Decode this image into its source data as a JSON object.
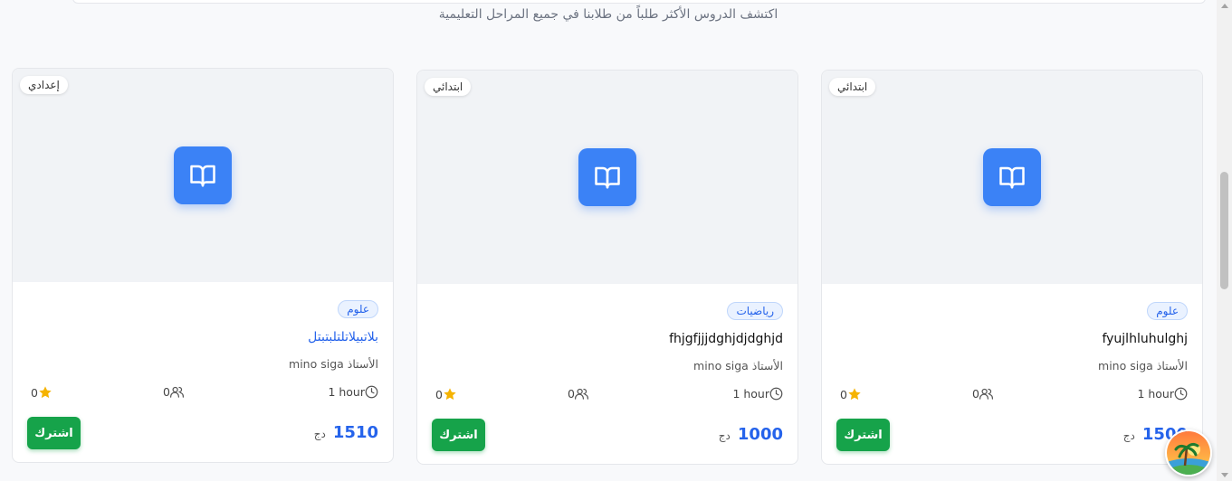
{
  "section": {
    "subtitle": "اكتشف الدروس الأكثر طلباً من طلابنا في جميع المراحل التعليمية"
  },
  "colors": {
    "accent_blue": "#3b82f6",
    "subscribe_green": "#16a34a",
    "star": "#f5b301"
  },
  "cards": [
    {
      "level": "ابتدائي",
      "subject": "علوم",
      "title": "fyujlhluhulghj",
      "teacher": "الأستاذ mino siga",
      "duration": "1 hour",
      "students": "0",
      "rating": "0",
      "price": "1500",
      "currency": "دج",
      "subscribe_label": "اشترك"
    },
    {
      "level": "ابتدائي",
      "subject": "رياضيات",
      "title": "fhjgfjjjdghjdjdghjd",
      "teacher": "الأستاذ mino siga",
      "duration": "1 hour",
      "students": "0",
      "rating": "0",
      "price": "1000",
      "currency": "دج",
      "subscribe_label": "اشترك"
    },
    {
      "level": "إعدادي",
      "subject": "علوم",
      "title": "بلاتبيلاتلتلبتبتل",
      "teacher": "الأستاذ mino siga",
      "duration": "1 hour",
      "students": "0",
      "rating": "0",
      "price": "1510",
      "currency": "دج",
      "subscribe_label": "اشترك"
    }
  ],
  "icons": {
    "book": "book-open-icon",
    "clock": "clock-icon",
    "users": "users-icon",
    "star": "star-icon"
  }
}
